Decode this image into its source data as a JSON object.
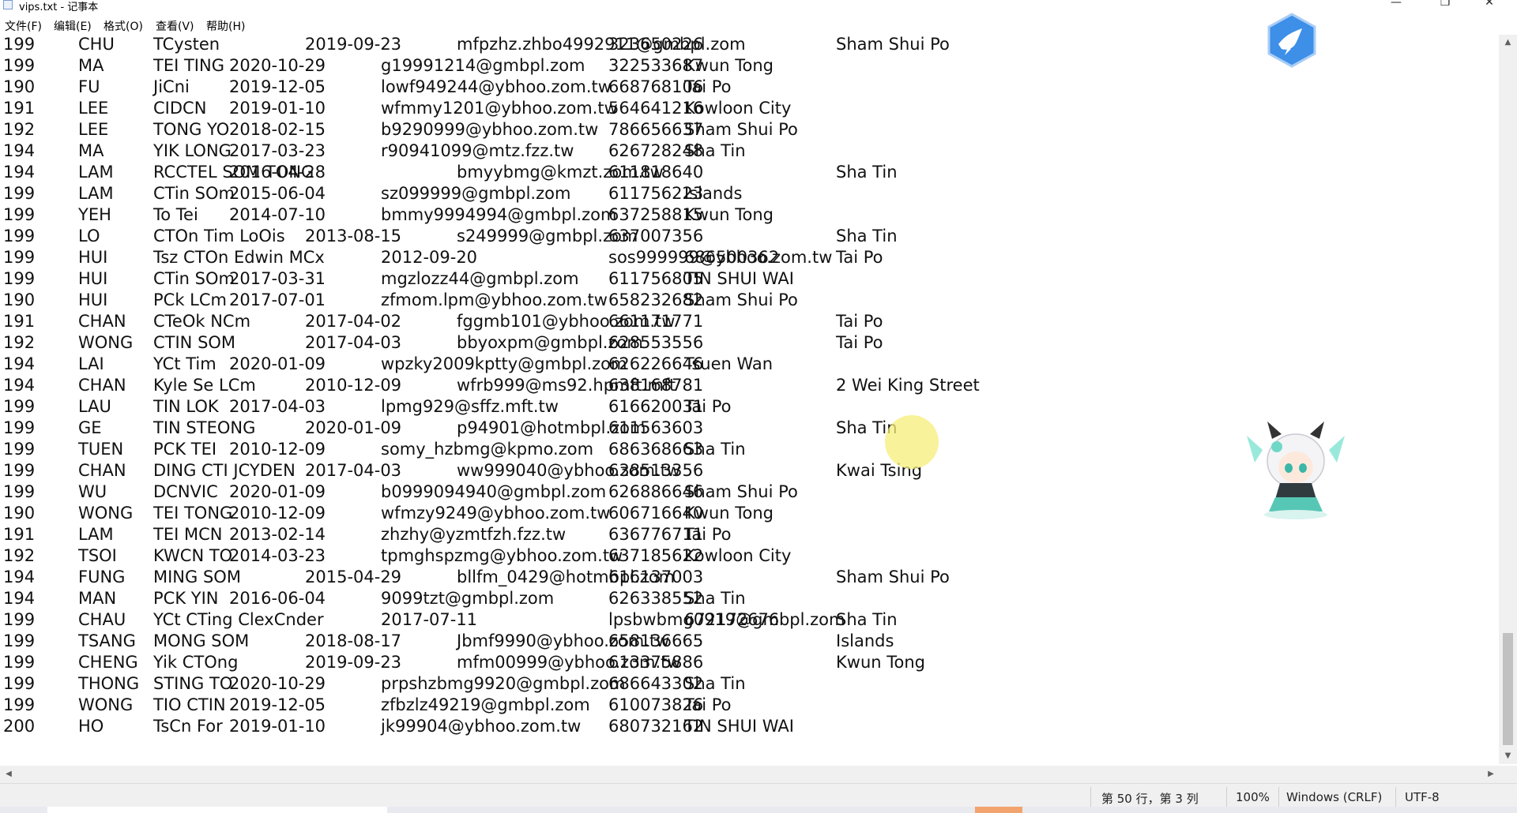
{
  "window": {
    "title": "vips.txt - 记事本",
    "minimize": "—",
    "maximize": "❐",
    "close": "✕"
  },
  "menu": [
    "文件(F)",
    "编辑(E)",
    "格式(O)",
    "查看(V)",
    "帮助(H)"
  ],
  "lines": [
    [
      "199",
      "CHU",
      "TCysten",
      "",
      "2019-09-23",
      "",
      "mfpzhz.zhbo4992911@gmbpl.zom",
      "323650226",
      "",
      "Sham Shui Po"
    ],
    [
      "199",
      "MA",
      "TEI TING",
      "2020-10-29",
      "",
      "g19991214@gmbpl.zom",
      "",
      "322533687",
      "Kwun Tong",
      ""
    ],
    [
      "190",
      "FU",
      "JiCni",
      "2019-12-05",
      "",
      "lowf949244@ybhoo.zom.tw",
      "",
      "668768106",
      "Tai Po",
      ""
    ],
    [
      "191",
      "LEE",
      "CIDCN",
      "2019-01-10",
      "",
      "wfmmy1201@ybhoo.zom.tw",
      "",
      "564641216",
      "Kowloon City",
      ""
    ],
    [
      "192",
      "LEE",
      "TONG YO",
      "2018-02-15",
      "",
      "b9290999@ybhoo.zom.tw",
      "",
      "786656637",
      "Sham Shui Po",
      ""
    ],
    [
      "194",
      "MA",
      "YIK LONG",
      "2017-03-23",
      "",
      "r90941099@mtz.fzz.tw",
      "",
      "626728248",
      "Sha Tin",
      ""
    ],
    [
      "194",
      "LAM",
      "RCCTEL SOM TONG",
      "2016-04-28",
      "",
      "",
      "bmyybmg@kmzt.zom.tw",
      "611818640",
      "",
      "Sha Tin"
    ],
    [
      "199",
      "LAM",
      "CTin SOm",
      "2015-06-04",
      "",
      "sz099999@gmbpl.zom",
      "",
      "611756223",
      "Islands",
      ""
    ],
    [
      "199",
      "YEH",
      "To Tei",
      "2014-07-10",
      "",
      "bmmy9994994@gmbpl.zom",
      "",
      "637258815",
      "Kwun Tong",
      ""
    ],
    [
      "199",
      "LO",
      "CTOn Tim LoOis",
      "",
      "2013-08-15",
      "",
      "s249999@gmbpl.zom",
      "637007356",
      "",
      "Sha Tin"
    ],
    [
      "199",
      "HUI",
      "Tsz CTOn Edwin MCx",
      "",
      "",
      "2012-09-20",
      "",
      "sos999999@ybhoo.zom.tw",
      "686500362",
      "Tai Po"
    ],
    [
      "199",
      "HUI",
      "CTin SOm",
      "2017-03-31",
      "",
      "mgzlozz44@gmbpl.zom",
      "",
      "611756805",
      "TIN SHUI WAI",
      ""
    ],
    [
      "190",
      "HUI",
      "PCk LCm",
      "2017-07-01",
      "",
      "zfmom.lpm@ybhoo.zom.tw",
      "",
      "658232682",
      "Sham Shui Po",
      ""
    ],
    [
      "191",
      "CHAN",
      "CTeOk NCm",
      "",
      "2017-04-02",
      "",
      "fggmb101@ybhoo.zom.tw",
      "661171771",
      "",
      "Tai Po"
    ],
    [
      "192",
      "WONG",
      "CTIN SOM",
      "",
      "2017-04-03",
      "",
      "bbyoxpm@gmbpl.zom",
      "628553556",
      "",
      "Tai Po"
    ],
    [
      "194",
      "LAI",
      "YCt Tim",
      "2020-01-09",
      "",
      "wpzky2009kptty@gmbpl.zom",
      "",
      "626226646",
      "Tsuen Wan",
      ""
    ],
    [
      "194",
      "CHAN",
      "Kyle Se LCm",
      "",
      "2010-12-09",
      "",
      "wfrb999@ms92.hpmft.mft",
      "638168781",
      "",
      "2 Wei King Street"
    ],
    [
      "199",
      "LAU",
      "TIN LOK",
      "2017-04-03",
      "",
      "lpmg929@sffz.mft.tw",
      "",
      "616620031",
      "Tai Po",
      ""
    ],
    [
      "199",
      "GE",
      "TIN STEONG",
      "",
      "2020-01-09",
      "",
      "p94901@hotmbpl.zom",
      "611563603",
      "",
      "Sha Tin"
    ],
    [
      "199",
      "TUEN",
      "PCK TEI",
      "2010-12-09",
      "",
      "somy_hzbmg@kpmo.zom",
      "",
      "686368663",
      "Sha Tin",
      ""
    ],
    [
      "199",
      "CHAN",
      "DING CTI JCYDEN",
      "",
      "2017-04-03",
      "",
      "ww999040@ybhoo.zom.tw",
      "638513356",
      "",
      "Kwai Tsing"
    ],
    [
      "199",
      "WU",
      "DCNVIC",
      "2020-01-09",
      "",
      "b0999094940@gmbpl.zom",
      "",
      "626886646",
      "Sham Shui Po",
      ""
    ],
    [
      "190",
      "WONG",
      "TEI TONG",
      "2010-12-09",
      "",
      "wfmzy9249@ybhoo.zom.tw",
      "",
      "606716640",
      "Kwun Tong",
      ""
    ],
    [
      "191",
      "LAM",
      "TEI MCN",
      "2013-02-14",
      "",
      "zhzhy@yzmtfzh.fzz.tw",
      "",
      "636776711",
      "Tai Po",
      ""
    ],
    [
      "192",
      "TSOI",
      "KWCN TO",
      "2014-03-23",
      "",
      "tpmghspzmg@ybhoo.zom.tw",
      "",
      "637185622",
      "Kowloon City",
      ""
    ],
    [
      "194",
      "FUNG",
      "MING SOM",
      "",
      "2015-04-29",
      "",
      "bllfm_0429@hotmbpl.zom",
      "616137003",
      "",
      "Sham Shui Po"
    ],
    [
      "194",
      "MAN",
      "PCK YIN",
      "2016-06-04",
      "",
      "9099tzt@gmbpl.zom",
      "",
      "626338552",
      "Sha Tin",
      ""
    ],
    [
      "199",
      "CHAU",
      "YCt CTing ClexCnder",
      "",
      "",
      "2017-07-11",
      "",
      "lpsbwbmg0919@gmbpl.zom",
      "672172676",
      "Sha Tin"
    ],
    [
      "199",
      "TSANG",
      "MONG SOM",
      "",
      "2018-08-17",
      "",
      "Jbmf9990@ybhoo.zom.tw",
      "658136665",
      "",
      "Islands"
    ],
    [
      "199",
      "CHENG",
      "Yik CTOng",
      "",
      "2019-09-23",
      "",
      "mfm00999@ybhoo.zom.tw",
      "613375886",
      "",
      "Kwun Tong"
    ],
    [
      "199",
      "THONG",
      "STING TO",
      "2020-10-29",
      "",
      "prpshzbmg9920@gmbpl.zom",
      "",
      "686643302",
      "Sha Tin",
      ""
    ],
    [
      "199",
      "WONG",
      "TIO CTIN",
      "2019-12-05",
      "",
      "zfbzlz49219@gmbpl.zom",
      "",
      "610073826",
      "Tai Po",
      ""
    ],
    [
      "200",
      "HO",
      "TsCn For",
      "2019-01-10",
      "",
      "jk99904@ybhoo.zom.tw",
      "",
      "680732162",
      "TIN SHUI WAI",
      ""
    ]
  ],
  "status": {
    "position": "第 50 行，第 3 列",
    "zoom": "100%",
    "line_ending": "Windows (CRLF)",
    "encoding": "UTF-8"
  },
  "scrollbar": {
    "up": "▲",
    "down": "▼",
    "left": "◀",
    "right": "▶"
  }
}
